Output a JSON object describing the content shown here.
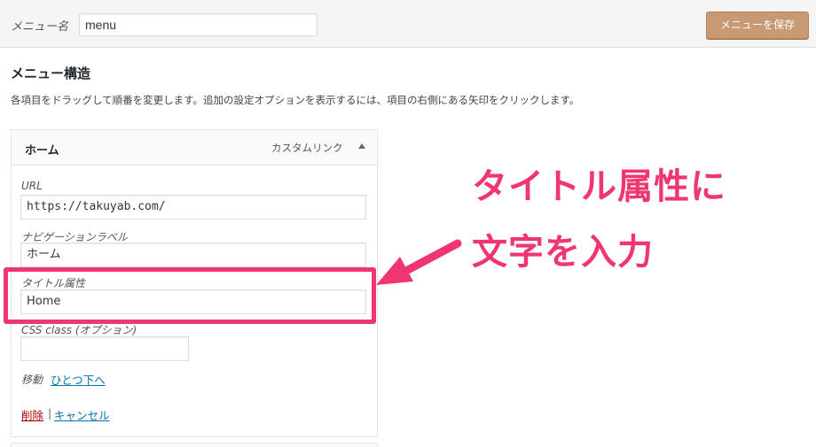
{
  "header": {
    "menu_name_label": "メニュー名",
    "menu_name_value": "menu",
    "save_label": "メニューを保存"
  },
  "structure": {
    "title": "メニュー構造",
    "description": "各項目をドラッグして順番を変更します。追加の設定オプションを表示するには、項目の右側にある矢印をクリックします。"
  },
  "menu_item": {
    "title": "ホーム",
    "type": "カスタムリンク",
    "url_label": "URL",
    "url_value": "https://takuyab.com/",
    "nav_label": "ナビゲーションラベル",
    "nav_value": "ホーム",
    "title_attr_label": "タイトル属性",
    "title_attr_value": "Home",
    "css_label": "CSS class (オプション)",
    "css_value": "",
    "move_label": "移動",
    "move_link": "ひとつ下へ",
    "delete_link": "削除",
    "separator": "|",
    "cancel_link": "キャンセル"
  },
  "annotation": {
    "line1": "タイトル属性に",
    "line2": "文字を入力",
    "color": "#f0366f"
  }
}
